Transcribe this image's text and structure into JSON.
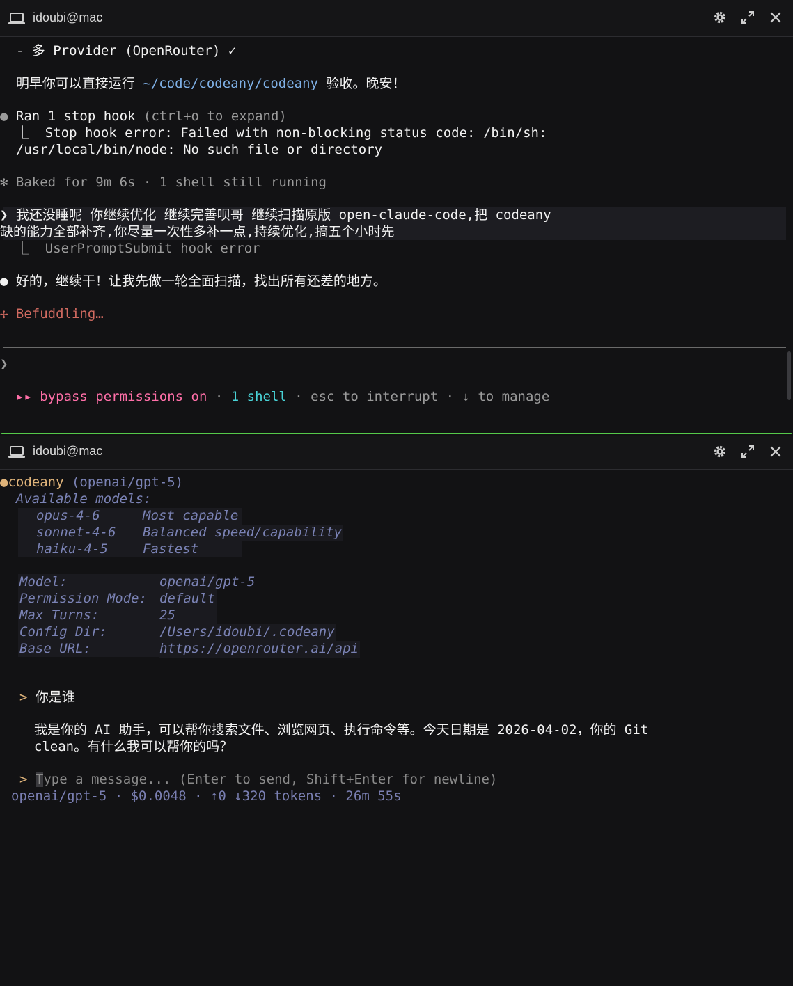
{
  "top": {
    "title": "idoubi@mac",
    "lines": {
      "provider": "  - 多 Provider (OpenRouter) ✓",
      "tomorrow_pre": "  明早你可以直接运行 ",
      "tomorrow_path": "~/code/codeany/codeany",
      "tomorrow_post": " 验收。晚安！",
      "hook_bullet": "●",
      "hook_main": " Ran 1 stop hook",
      "hook_hint": " (ctrl+o to expand)",
      "hook_err1": "  ⎿  Stop hook error: Failed with non-blocking status code: /bin/sh:",
      "hook_err2": "  /usr/local/bin/node: No such file or directory",
      "baked": "✻ Baked for 9m 6s · 1 shell still running",
      "prompt1": "❯ 我还没睡呢 你继续优化 继续完善呗哥 继续扫描原版 open-claude-code,把 codeany",
      "prompt2": "缺的能力全部补齐,你尽量一次性多补一点,持续优化,搞五个小时先",
      "submit_err": "  ⎿  UserPromptSubmit hook error",
      "reply_bullet": "●",
      "reply": " 好的，继续干！让我先做一轮全面扫描，找出所有还差的地方。",
      "befuddling": "✢ Befuddling…",
      "input_prompt": "❯",
      "status_arrows": "  ▸▸ ",
      "status_bypass": "bypass permissions on",
      "status_dot1": " · ",
      "status_shell": "1 shell",
      "status_rest": " · esc to interrupt · ↓ to manage"
    }
  },
  "bottom": {
    "title": "idoubi@mac",
    "app": "codeany",
    "app_model": " (openai/gpt-5)",
    "available": "  Available models:",
    "models": [
      {
        "name": "opus-4-6",
        "desc": "Most capable"
      },
      {
        "name": "sonnet-4-6",
        "desc": "Balanced speed/capability"
      },
      {
        "name": "haiku-4-5",
        "desc": "Fastest"
      }
    ],
    "config": [
      {
        "k": "Model:",
        "v": "openai/gpt-5"
      },
      {
        "k": "Permission Mode:",
        "v": "default"
      },
      {
        "k": "Max Turns:",
        "v": "25"
      },
      {
        "k": "Config Dir:",
        "v": "/Users/idoubi/.codeany"
      },
      {
        "k": "Base URL:",
        "v": "https://openrouter.ai/api"
      }
    ],
    "user_msg": "你是谁",
    "answer1": "  我是你的 AI 助手，可以帮你搜索文件、浏览网页、执行命令等。今天日期是 2026-04-02，你的 Git",
    "answer2": "  clean。有什么我可以帮你的吗？",
    "input_cursor": "T",
    "input_placeholder": "ype a message... (Enter to send, Shift+Enter for newline)",
    "status_line": "openai/gpt-5 · $0.0048 · ↑0 ↓320 tokens · 26m 55s",
    "prompt_char": ">"
  },
  "colors": {
    "green_focus": "#55c94a",
    "pink": "#ff6fa8",
    "cyan": "#49d3d7",
    "orange": "#e0b47a"
  }
}
